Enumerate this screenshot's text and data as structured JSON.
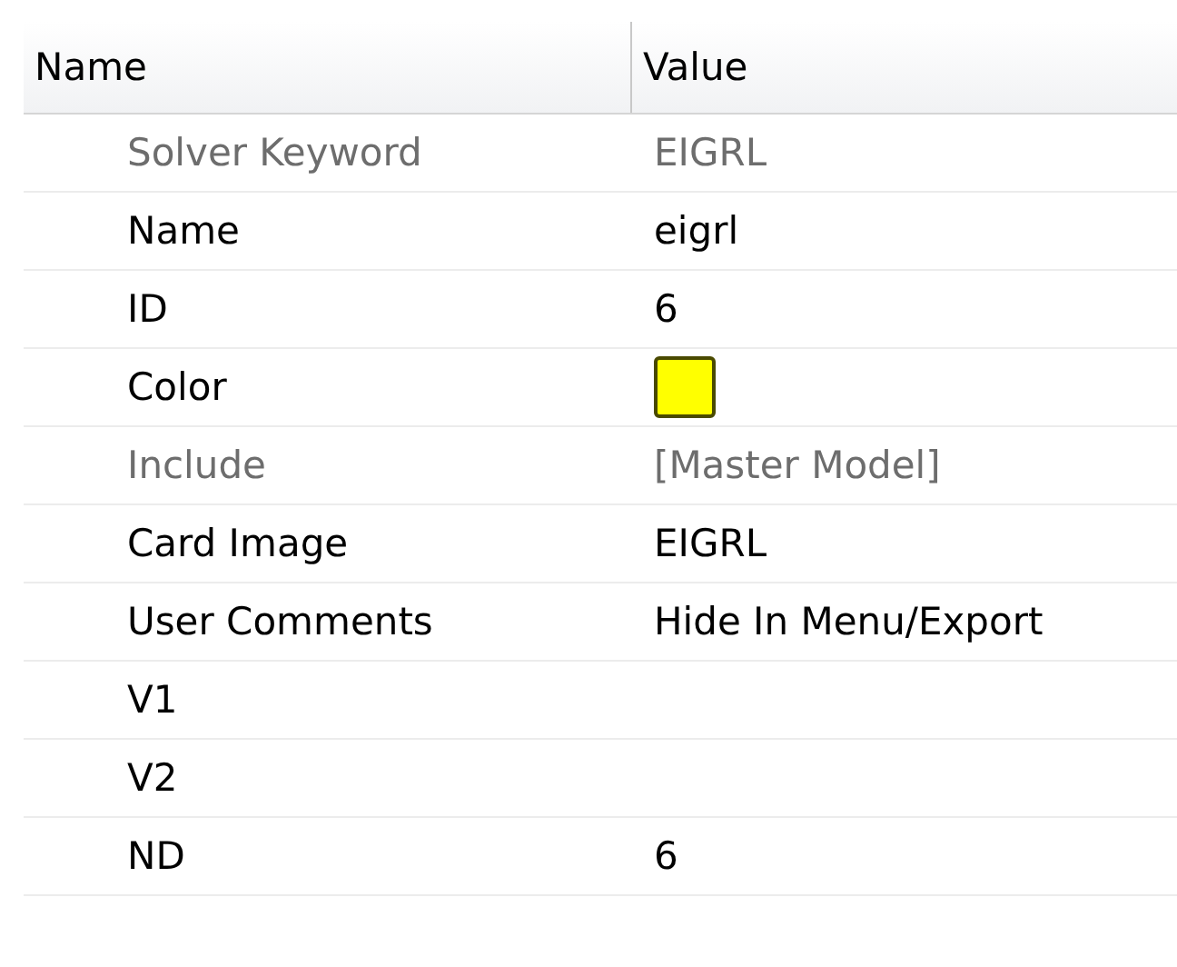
{
  "columns": [
    "Name",
    "Value"
  ],
  "rows": [
    {
      "kind": "text",
      "name": "Solver Keyword",
      "value": "EIGRL",
      "disabled": true
    },
    {
      "kind": "text",
      "name": "Name",
      "value": "eigrl",
      "disabled": false
    },
    {
      "kind": "text",
      "name": "ID",
      "value": "6",
      "disabled": false
    },
    {
      "kind": "color",
      "name": "Color",
      "color": "#ffff00",
      "disabled": false
    },
    {
      "kind": "text",
      "name": "Include",
      "value": "[Master Model]",
      "disabled": true
    },
    {
      "kind": "text",
      "name": "Card Image",
      "value": "EIGRL",
      "disabled": false
    },
    {
      "kind": "text",
      "name": "User Comments",
      "value": "Hide In Menu/Export",
      "disabled": false
    },
    {
      "kind": "text",
      "name": "V1",
      "disabled": false
    },
    {
      "kind": "text",
      "name": "V2",
      "disabled": false
    },
    {
      "kind": "text",
      "name": "ND",
      "value": "6",
      "disabled": false
    }
  ]
}
